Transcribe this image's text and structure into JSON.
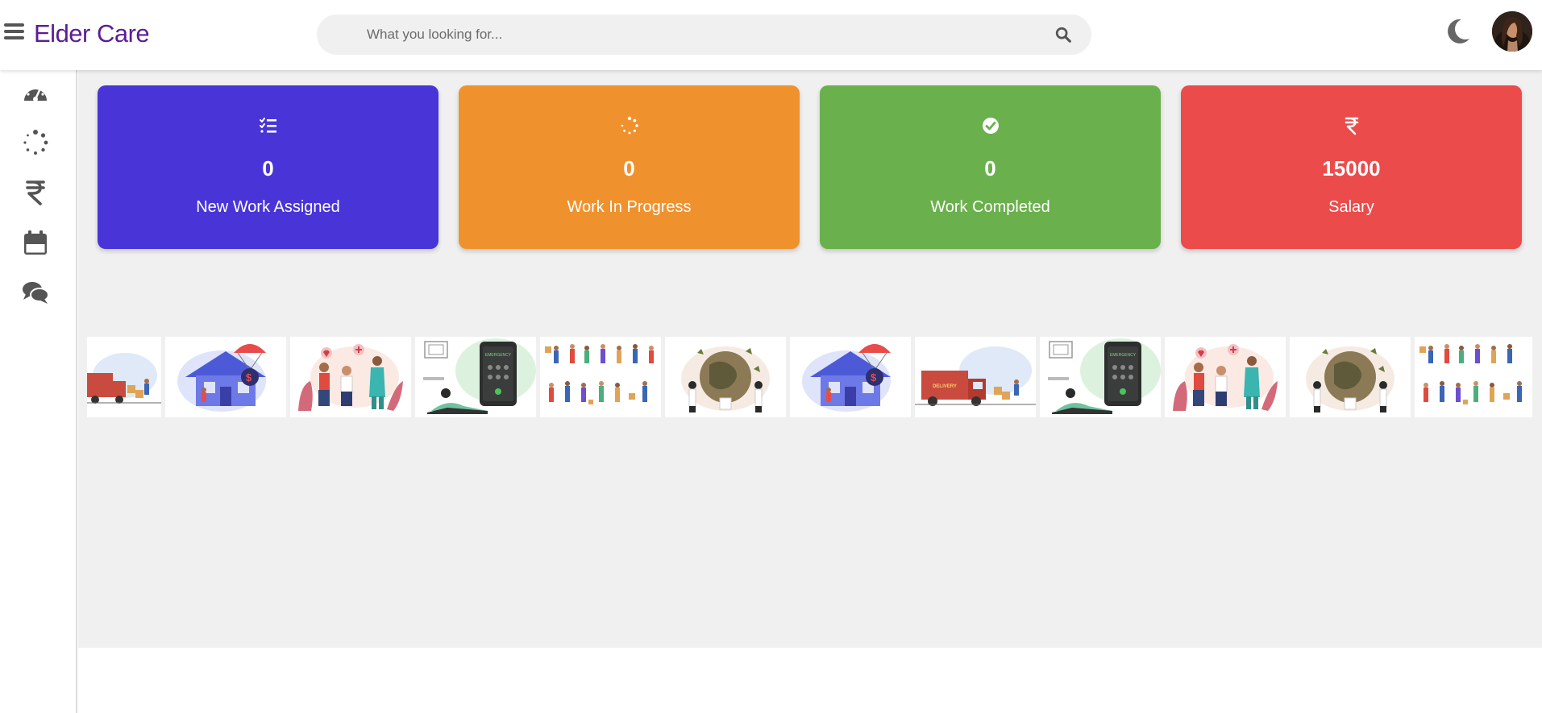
{
  "app": {
    "title": "Elder Care"
  },
  "search": {
    "placeholder": "What you looking for..."
  },
  "colors": {
    "brand": "#5b1d96",
    "card_blue": "#4934d8",
    "card_orange": "#ef922e",
    "card_green": "#6ab04c",
    "card_red": "#eb4b4b"
  },
  "sidebar": {
    "items": [
      {
        "icon": "dashboard-icon"
      },
      {
        "icon": "spinner-icon"
      },
      {
        "icon": "rupee-icon"
      },
      {
        "icon": "calendar-icon"
      },
      {
        "icon": "chat-icon"
      }
    ]
  },
  "cards": [
    {
      "icon": "task-list-icon",
      "value": "0",
      "label": "New Work Assigned"
    },
    {
      "icon": "spinner-icon",
      "value": "0",
      "label": "Work In Progress"
    },
    {
      "icon": "check-circle-icon",
      "value": "0",
      "label": "Work Completed"
    },
    {
      "icon": "rupee-icon",
      "value": "15000",
      "label": "Salary"
    }
  ],
  "gallery": {
    "items": [
      {
        "icon": "delivery-truck-illustration",
        "text": ""
      },
      {
        "icon": "house-insurance-illustration",
        "text": ""
      },
      {
        "icon": "doctor-consultation-illustration",
        "text": ""
      },
      {
        "icon": "emergency-call-illustration",
        "text": "EMERGENCY"
      },
      {
        "icon": "people-group-illustration",
        "text": ""
      },
      {
        "icon": "globe-care-illustration",
        "text": ""
      },
      {
        "icon": "house-insurance-illustration",
        "text": ""
      },
      {
        "icon": "delivery-truck-illustration",
        "text": "DELIVERY"
      },
      {
        "icon": "emergency-call-illustration",
        "text": "EMERGENCY"
      },
      {
        "icon": "doctor-consultation-illustration",
        "text": ""
      },
      {
        "icon": "globe-care-illustration",
        "text": ""
      },
      {
        "icon": "people-group-illustration",
        "text": ""
      }
    ]
  }
}
